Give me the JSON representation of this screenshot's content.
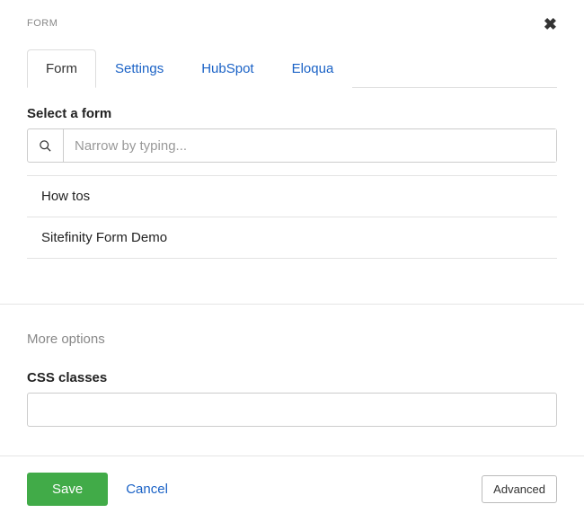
{
  "header": {
    "title": "FORM"
  },
  "tabs": [
    {
      "label": "Form",
      "active": true
    },
    {
      "label": "Settings",
      "active": false
    },
    {
      "label": "HubSpot",
      "active": false
    },
    {
      "label": "Eloqua",
      "active": false
    }
  ],
  "form_section": {
    "label": "Select a form",
    "search_placeholder": "Narrow by typing...",
    "items": [
      {
        "title": "How tos"
      },
      {
        "title": "Sitefinity Form Demo"
      }
    ]
  },
  "more_options": {
    "label": "More options",
    "css_label": "CSS classes",
    "css_value": ""
  },
  "footer": {
    "save": "Save",
    "cancel": "Cancel",
    "advanced": "Advanced"
  }
}
